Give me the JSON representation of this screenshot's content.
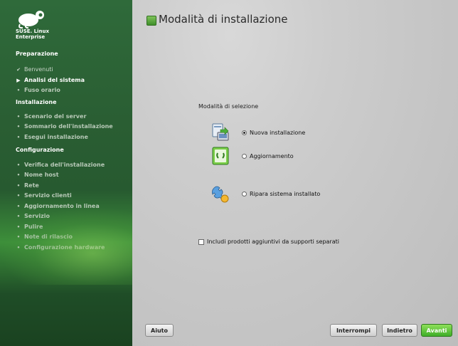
{
  "sidebar": {
    "brand": "SUSE Linux Enterprise",
    "brand_line1": "SUSE. Linux",
    "brand_line2": "Enterprise",
    "sections": [
      {
        "title": "Preparazione",
        "items": [
          {
            "label": "Benvenuti",
            "state": "done"
          },
          {
            "label": "Analisi del sistema",
            "state": "current"
          },
          {
            "label": "Fuso orario",
            "state": "todo"
          }
        ]
      },
      {
        "title": "Installazione",
        "items": [
          {
            "label": "Scenario del server",
            "state": "todo"
          },
          {
            "label": "Sommario dell'installazione",
            "state": "todo"
          },
          {
            "label": "Esegui installazione",
            "state": "todo"
          }
        ]
      },
      {
        "title": "Configurazione",
        "items": [
          {
            "label": "Verifica dell'installazione",
            "state": "todo"
          },
          {
            "label": "Nome host",
            "state": "todo"
          },
          {
            "label": "Rete",
            "state": "todo"
          },
          {
            "label": "Servizio clienti",
            "state": "todo"
          },
          {
            "label": "Aggiornamento in linea",
            "state": "todo"
          },
          {
            "label": "Servizio",
            "state": "todo"
          },
          {
            "label": "Pulire",
            "state": "todo"
          },
          {
            "label": "Note di rilascio",
            "state": "todo"
          },
          {
            "label": "Configurazione hardware",
            "state": "todo"
          }
        ]
      }
    ]
  },
  "main": {
    "title": "Modalità di installazione",
    "selection_label": "Modalità di selezione",
    "options": [
      {
        "label": "Nuova installazione",
        "selected": true,
        "icon": "new-install-icon"
      },
      {
        "label": "Aggiornamento",
        "selected": false,
        "icon": "update-icon"
      },
      {
        "label": "Ripara sistema installato",
        "selected": false,
        "icon": "repair-icon"
      }
    ],
    "addon_checkbox": {
      "label": "Includi prodotti aggiuntivi da supporti separati",
      "checked": false
    }
  },
  "buttons": {
    "help": "Aiuto",
    "abort": "Interrompi",
    "back": "Indietro",
    "next": "Avanti"
  },
  "colors": {
    "sidebar_green": "#2f6a3a",
    "next_button": "#3fae27",
    "content_bg": "#c6c6c6"
  }
}
